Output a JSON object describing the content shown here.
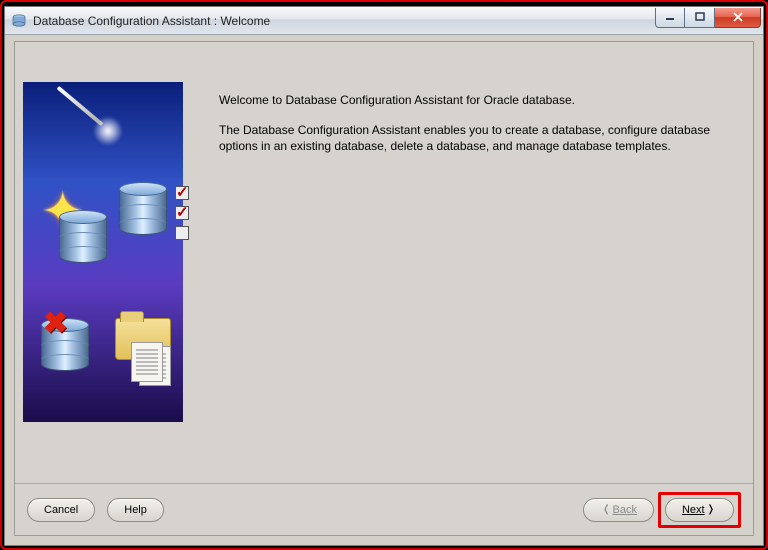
{
  "window": {
    "title": "Database Configuration Assistant : Welcome"
  },
  "content": {
    "line1": "Welcome to Database Configuration Assistant for Oracle database.",
    "line2": "The Database Configuration Assistant enables you to create a database, configure database options in an existing database, delete a database, and manage database templates."
  },
  "buttons": {
    "cancel": "Cancel",
    "help": "Help",
    "back": "Back",
    "next": "Next"
  },
  "icons": {
    "minimize": "minimize-icon",
    "maximize": "maximize-icon",
    "close": "close-icon",
    "back_arrow": "chevron-left-icon",
    "next_arrow": "chevron-right-icon"
  }
}
